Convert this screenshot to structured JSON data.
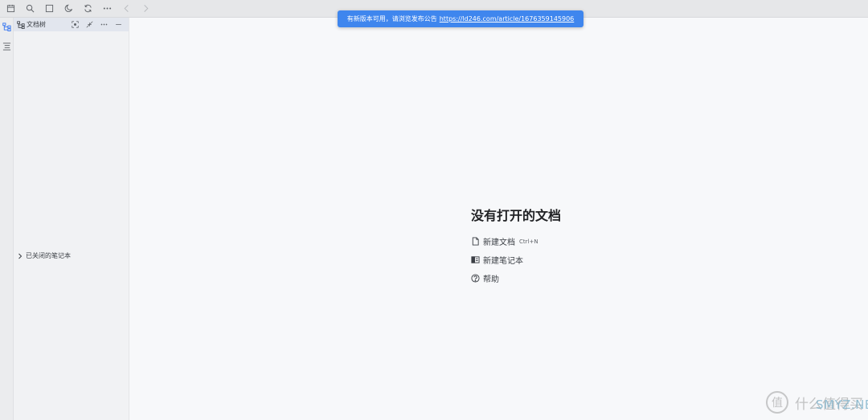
{
  "toolbar": {
    "icons": [
      "calendar-icon",
      "search-icon",
      "square-icon",
      "moon-icon",
      "sync-icon",
      "more-icon",
      "back-icon",
      "forward-icon"
    ]
  },
  "dock": {
    "items": [
      {
        "icon": "file-tree-icon",
        "active": true
      },
      {
        "icon": "outline-icon",
        "active": false
      }
    ]
  },
  "filetree": {
    "title": "文档树",
    "closed_notebooks_label": "已关闭的笔记本"
  },
  "notice": {
    "text": "有新版本可用，请浏览发布公告",
    "link": "https://ld246.com/article/1676359145906"
  },
  "empty": {
    "title": "没有打开的文档",
    "new_doc_label": "新建文档",
    "new_doc_hotkey": "Ctrl+N",
    "new_notebook_label": "新建笔记本",
    "help_label": "帮助"
  },
  "watermark": {
    "logo_char": "值",
    "text": "什么值得买",
    "sub": "SMYZ.NET"
  },
  "colors": {
    "accent": "#3f86ee",
    "active_dock": "#3575f0",
    "background": "#f7f8fa"
  }
}
